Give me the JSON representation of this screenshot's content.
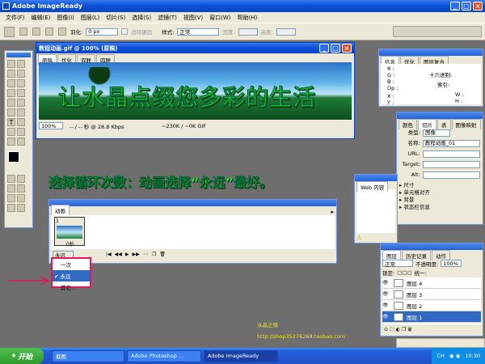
{
  "app": {
    "title": "Adobe ImageReady"
  },
  "menubar": [
    "文件(F)",
    "编辑(E)",
    "图像(I)",
    "图层(L)",
    "切片(S)",
    "选择(S)",
    "滤镜(T)",
    "视图(V)",
    "窗口(W)",
    "帮助(H)"
  ],
  "options": {
    "feather_label": "羽化:",
    "feather_value": "0 px",
    "antialias_label": "消除锯齿",
    "style_label": "样式:",
    "style_value": "正常",
    "width_label": "宽度:",
    "height_label": "高度:"
  },
  "doc": {
    "title": "教程动画.gif @ 100% (原稿)",
    "tabs": [
      "原稿",
      "优化",
      "双联",
      "四联"
    ],
    "banner_text": "让水晶点缀您多彩的生活",
    "zoom": "100%",
    "speed": "-- / -- 秒 @ 28.8 Kbps",
    "size": "~230K / ~0K GIF"
  },
  "instruction": "选择循环次数：动画选择“永远”最好。",
  "anim": {
    "title": "动画",
    "frame_number": "1",
    "frame_delay": "0秒",
    "loop_value": "永远",
    "loop_menu": [
      "一次",
      "永远",
      "其它..."
    ]
  },
  "info": {
    "tabs": [
      "信息",
      "优化",
      "图层复合"
    ],
    "r": "R :",
    "g": "G :",
    "b": "B :",
    "op": "Op :",
    "x": "X :",
    "y": "Y :",
    "hex_label": "十六进制:",
    "index_label": "索引:",
    "w": "W :",
    "h": "H :"
  },
  "slice": {
    "tabs": [
      "颜色",
      "切片",
      "表",
      "图像映射"
    ],
    "type_label": "类型:",
    "type_value": "图像",
    "name_label": "名称:",
    "name_value": "教程动画_01",
    "url_label": "URL:",
    "target_label": "Target:",
    "alt_label": "Alt:",
    "sections": [
      "尺寸",
      "单元格对齐",
      "背景",
      "状态栏信息"
    ]
  },
  "web": {
    "tabs": [
      "Web 内容"
    ]
  },
  "layers": {
    "tabs": [
      "图层",
      "历史记录",
      "动作"
    ],
    "blend": "正常",
    "opacity_label": "不透明度:",
    "opacity": "100%",
    "lock_label": "锁定:",
    "unify_label": "统一:",
    "items": [
      "图层 4",
      "图层 3",
      "图层 2",
      "图层 1"
    ]
  },
  "watermark": {
    "line1": "水晶之缘",
    "line2": "http://shop35276268.taobao.com"
  },
  "taskbar": {
    "start": "开始",
    "tasks": [
      "截图",
      "Adobe Photoshop ...",
      "Adobe ImageReady"
    ],
    "lang": "CH",
    "time": "10:30"
  }
}
